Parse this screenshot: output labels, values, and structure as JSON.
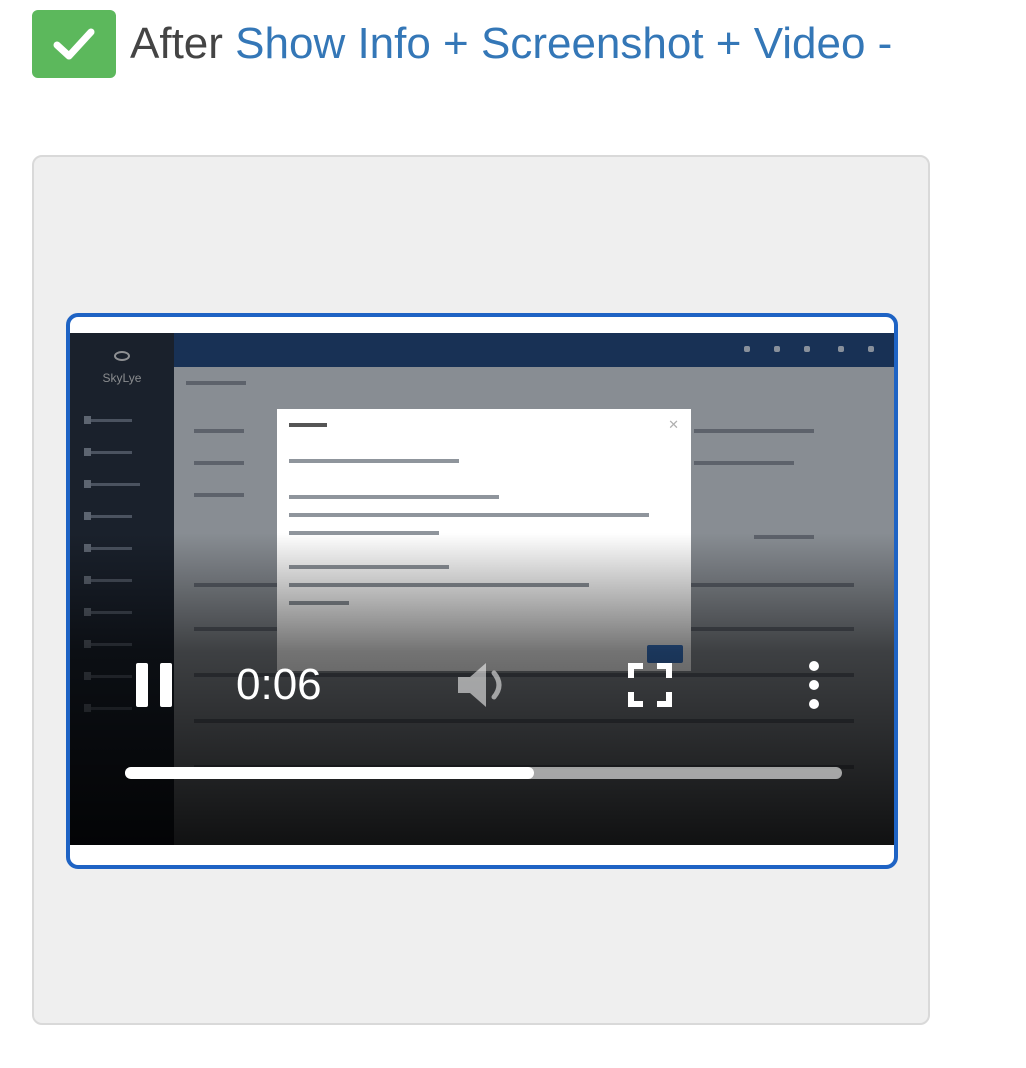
{
  "header": {
    "after_label": "After",
    "link_text": "Show Info + Screenshot + Video -",
    "status_color": "#5cb85c",
    "link_color": "#3477b7"
  },
  "video": {
    "border_color": "#1e63c4",
    "current_time": "0:06",
    "progress_percent": 57,
    "state": "playing",
    "icons": [
      "pause-icon",
      "volume-icon",
      "fullscreen-icon",
      "more-options-icon"
    ],
    "app": {
      "logo_text": "SkyLye"
    }
  }
}
